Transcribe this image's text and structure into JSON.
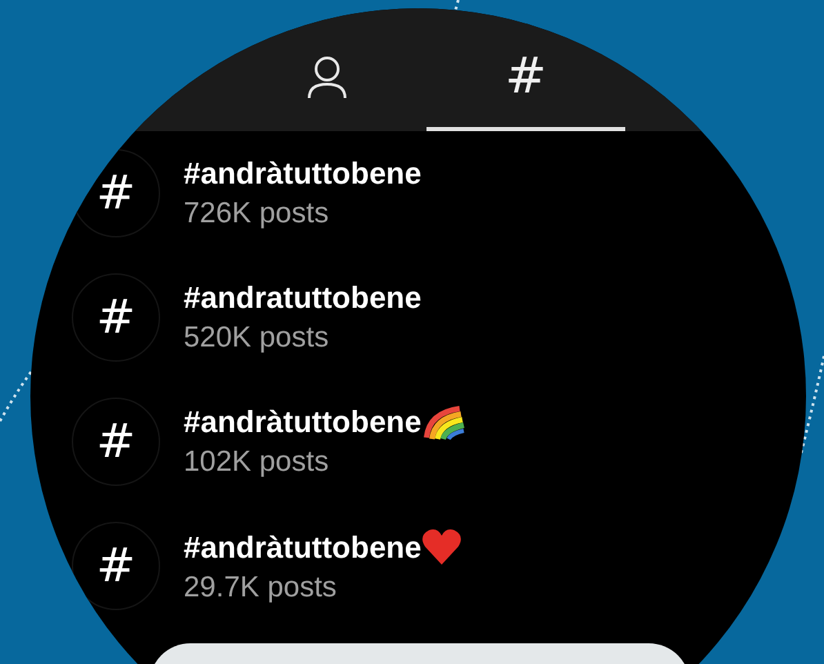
{
  "tabs": [
    {
      "kind": "person",
      "selected": false
    },
    {
      "kind": "hashtag",
      "label": "#",
      "selected": true
    }
  ],
  "results": [
    {
      "kind": "plain",
      "icon": "#",
      "tag": "#andràtuttobene",
      "posts": "726K posts"
    },
    {
      "kind": "plain",
      "icon": "#",
      "tag": "#andratuttobene",
      "posts": "520K posts"
    },
    {
      "kind": "rainbow",
      "icon": "#",
      "tag": "#andràtuttobene",
      "posts": "102K posts"
    },
    {
      "kind": "heart",
      "icon": "#",
      "tag": "#andràtuttobene",
      "posts": "29.7K posts"
    }
  ]
}
